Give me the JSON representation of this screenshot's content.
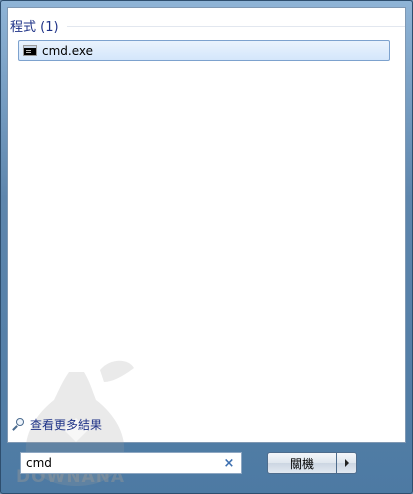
{
  "results": {
    "section_title": "程式 (1)",
    "items": [
      {
        "label": "cmd.exe",
        "icon": "cmd-icon"
      }
    ]
  },
  "more_results": {
    "label": "查看更多結果",
    "icon": "magnifier-icon"
  },
  "search": {
    "value": "cmd",
    "clear_glyph": "×"
  },
  "shutdown": {
    "label": "關機",
    "arrow_icon": "triangle-right-icon"
  },
  "watermark": {
    "text": "DOWNANA"
  }
}
